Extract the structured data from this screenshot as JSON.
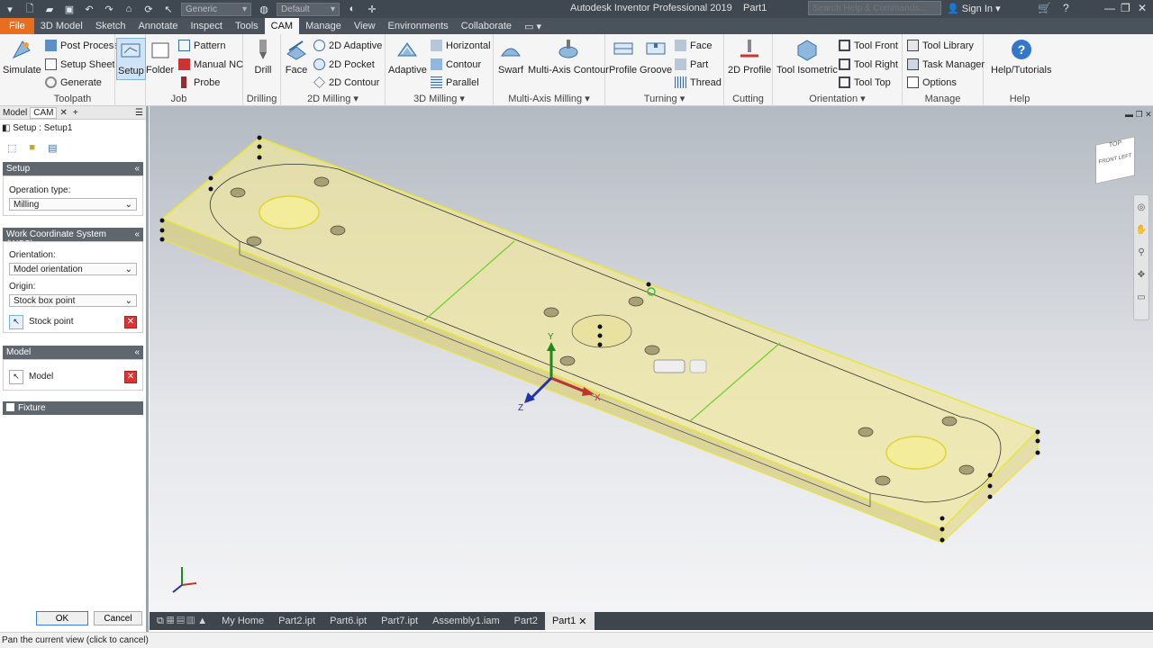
{
  "app": {
    "title": "Autodesk Inventor Professional 2019",
    "document": "Part1"
  },
  "qat": {
    "material": "Generic",
    "appearance": "Default",
    "search_placeholder": "Search Help & Commands...",
    "signin": "Sign In"
  },
  "tabs": [
    "File",
    "3D Model",
    "Sketch",
    "Annotate",
    "Inspect",
    "Tools",
    "CAM",
    "Manage",
    "View",
    "Environments",
    "Collaborate"
  ],
  "ribbon": {
    "toolpath": {
      "title": "Toolpath",
      "simulate": "Simulate",
      "post_process": "Post Process",
      "setup_sheet": "Setup Sheet",
      "generate": "Generate"
    },
    "job": {
      "title": "Job",
      "setup": "Setup",
      "folder": "Folder",
      "pattern": "Pattern",
      "manual_nc": "Manual NC",
      "probe": "Probe"
    },
    "drilling": {
      "title": "Drilling",
      "drill": "Drill"
    },
    "milling2d": {
      "title": "2D Milling",
      "face": "Face",
      "adaptive2d": "2D Adaptive",
      "pocket2d": "2D Pocket",
      "contour2d": "2D Contour"
    },
    "milling3d": {
      "title": "3D Milling",
      "adaptive": "Adaptive",
      "horizontal": "Horizontal",
      "contour": "Contour",
      "parallel": "Parallel"
    },
    "multiaxis": {
      "title": "Multi-Axis Milling",
      "swarf": "Swarf",
      "multi_axis_contour": "Multi-Axis Contour"
    },
    "turning": {
      "title": "Turning",
      "profile": "Profile",
      "groove": "Groove",
      "face": "Face",
      "part": "Part",
      "thread": "Thread"
    },
    "cutting": {
      "title": "Cutting",
      "profile2d": "2D Profile"
    },
    "orientation": {
      "title": "Orientation",
      "tool_isometric": "Tool Isometric",
      "tool_front": "Tool Front",
      "tool_right": "Tool Right",
      "tool_top": "Tool Top"
    },
    "manage": {
      "title": "Manage",
      "tool_library": "Tool Library",
      "task_manager": "Task Manager",
      "options": "Options"
    },
    "help": {
      "title": "Help",
      "help_tutorials": "Help/Tutorials"
    }
  },
  "leftpanel": {
    "tab_model": "Model",
    "tab_cam": "CAM",
    "breadcrumb": "Setup : Setup1",
    "setup": {
      "header": "Setup",
      "operation_type_label": "Operation type:",
      "operation_type": "Milling"
    },
    "wcs": {
      "header": "Work Coordinate System (WCS)",
      "orientation_label": "Orientation:",
      "orientation": "Model orientation",
      "origin_label": "Origin:",
      "origin": "Stock box point",
      "stock_point": "Stock point"
    },
    "model": {
      "header": "Model",
      "model_label": "Model"
    },
    "fixture": {
      "header": "Fixture"
    },
    "ok": "OK",
    "cancel": "Cancel"
  },
  "viewcube": {
    "top": "TOP",
    "front": "FRONT",
    "left": "LEFT"
  },
  "triad": {
    "x": "X",
    "y": "Y",
    "z": "Z"
  },
  "doctabs": [
    "My Home",
    "Part2.ipt",
    "Part6.ipt",
    "Part7.ipt",
    "Assembly1.iam",
    "Part2",
    "Part1"
  ],
  "status": "Pan the current view (click to cancel)"
}
